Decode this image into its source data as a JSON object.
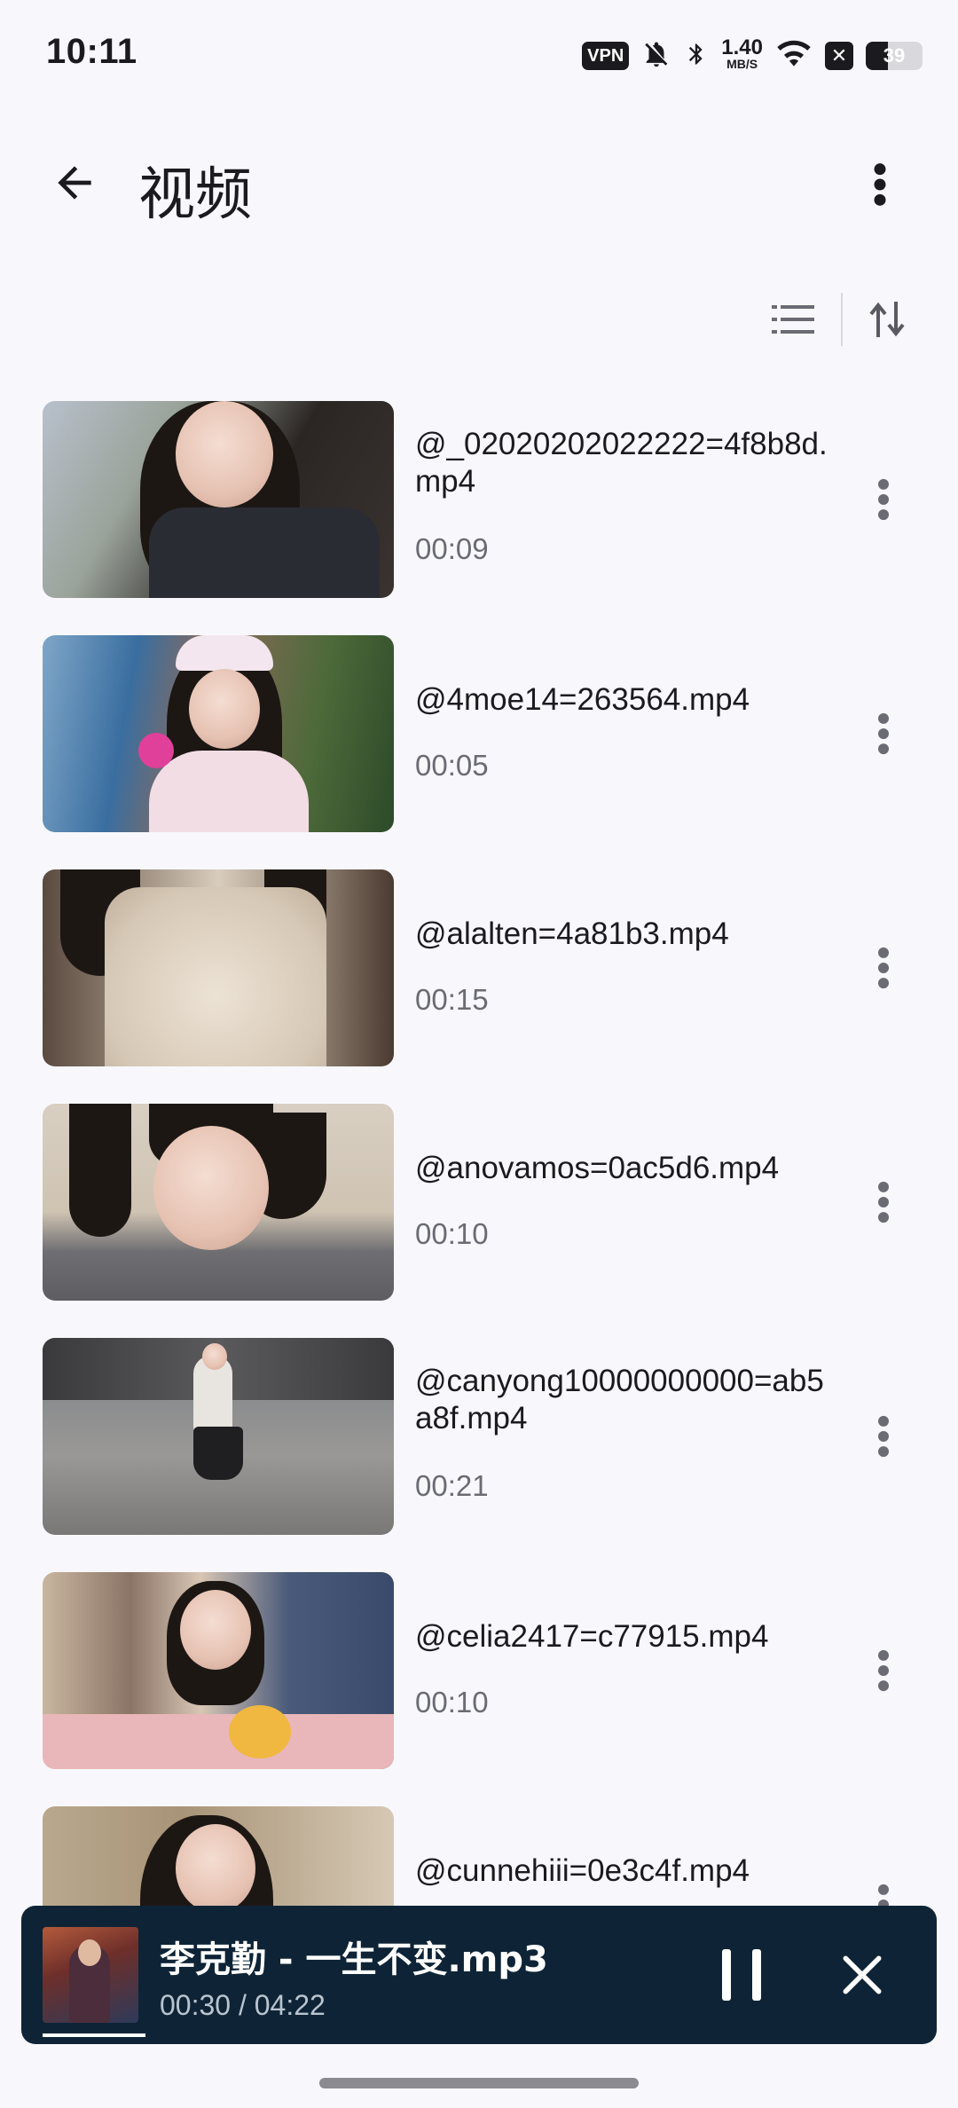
{
  "status_bar": {
    "time": "10:11",
    "vpn": "VPN",
    "speed_value": "1.40",
    "speed_unit": "MB/S",
    "battery": "39",
    "battery_level": 0.39
  },
  "app_bar": {
    "title": "视频"
  },
  "videos": [
    {
      "title": "@_02020202022222=4f8b8d.mp4",
      "duration": "00:09"
    },
    {
      "title": "@4moe14=263564.mp4",
      "duration": "00:05"
    },
    {
      "title": "@alalten=4a81b3.mp4",
      "duration": "00:15"
    },
    {
      "title": "@anovamos=0ac5d6.mp4",
      "duration": "00:10"
    },
    {
      "title": "@canyong10000000000=ab5a8f.mp4",
      "duration": "00:21"
    },
    {
      "title": "@celia2417=c77915.mp4",
      "duration": "00:10"
    },
    {
      "title": "@cunnehiii=0e3c4f.mp4",
      "duration": ""
    }
  ],
  "mini_player": {
    "title": "李克勤 - 一生不变.mp3",
    "time": "00:30 / 04:22",
    "progress": 0.118
  },
  "colors": {
    "background": "#f8f8fc",
    "player_bg": "#0e2436",
    "secondary_text": "#6b6b73"
  }
}
